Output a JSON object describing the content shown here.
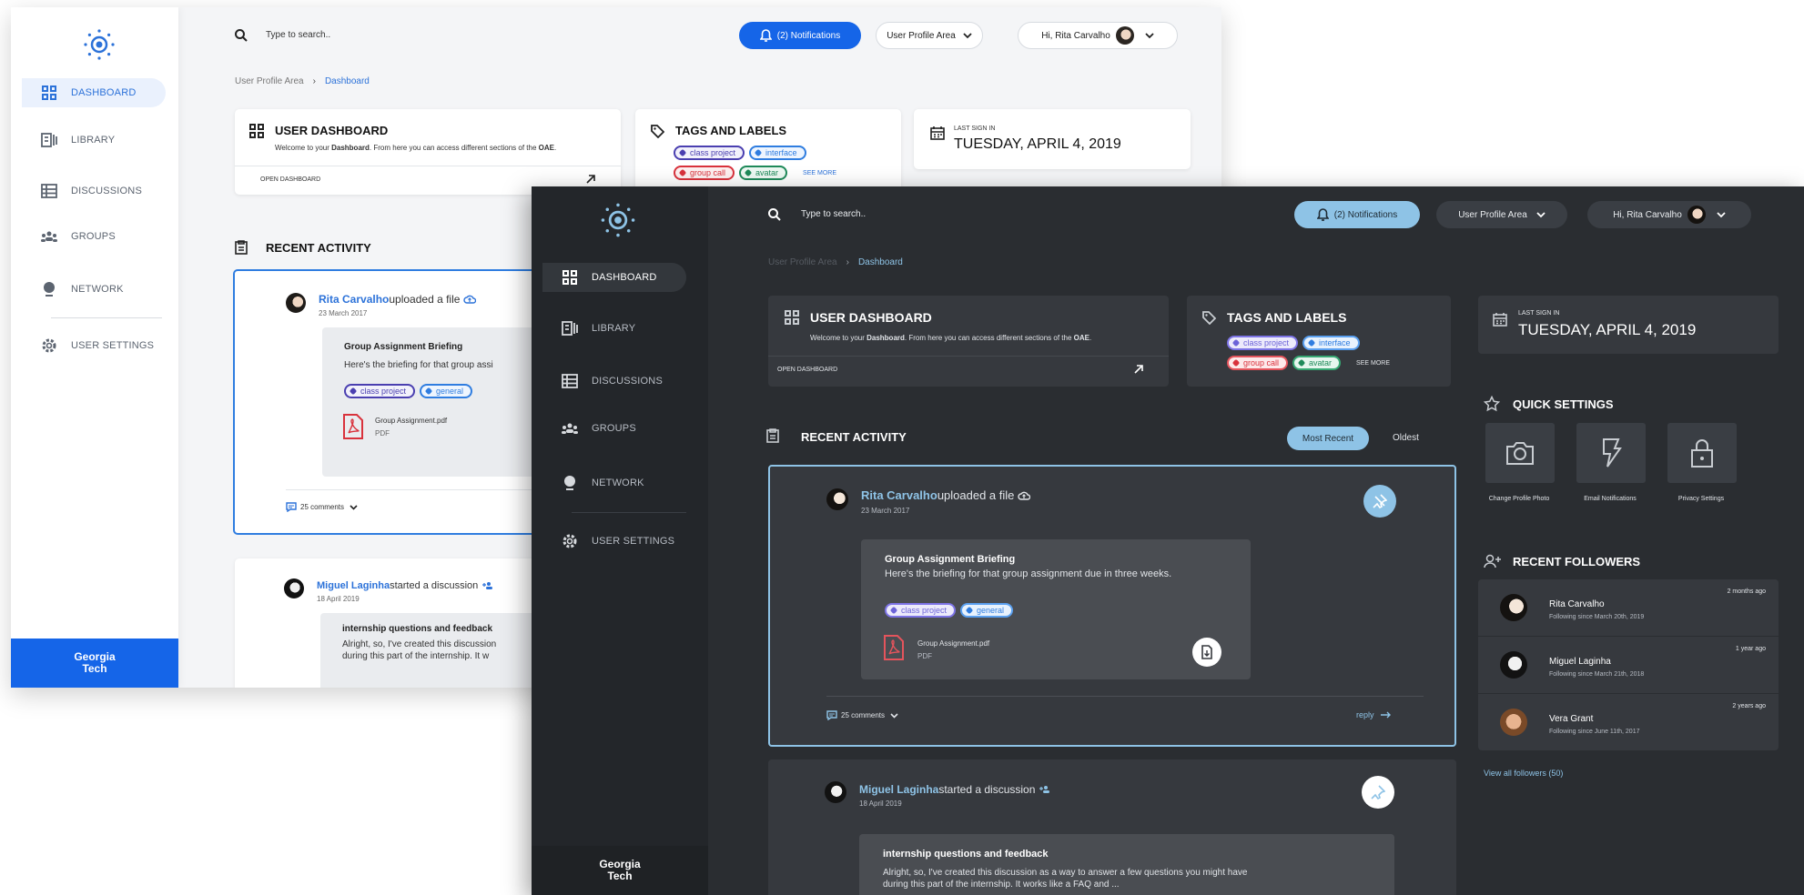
{
  "search": {
    "placeholder": "Type to search.."
  },
  "header": {
    "notifications": "(2) Notifications",
    "profile_area": "User Profile Area",
    "greeting": "Hi, Rita Carvalho"
  },
  "breadcrumb": {
    "parent": "User Profile Area",
    "current": "Dashboard"
  },
  "sidebar": {
    "items": [
      "DASHBOARD",
      "LIBRARY",
      "DISCUSSIONS",
      "GROUPS",
      "NETWORK",
      "USER SETTINGS"
    ],
    "logo_line1": "Georgia",
    "logo_line2": "Tech"
  },
  "dashboard_card": {
    "title": "USER DASHBOARD",
    "desc_pre": "Welcome to your ",
    "desc_bold1": "Dashboard",
    "desc_mid": ". From here you can access different sections of the ",
    "desc_bold2": "OAE",
    "desc_post": ".",
    "link": "OPEN DASHBOARD"
  },
  "tags_card": {
    "title": "TAGS AND LABELS",
    "tags": [
      "class project",
      "interface",
      "group call",
      "avatar"
    ],
    "see_more": "SEE MORE"
  },
  "last_sign_in": {
    "label": "LAST SIGN IN",
    "date": "TUESDAY, APRIL 4, 2019"
  },
  "recent_activity": {
    "title": "RECENT ACTIVITY",
    "sort_recent": "Most Recent",
    "sort_oldest": "Oldest"
  },
  "activity1": {
    "user": "Rita Carvalho",
    "action": " uploaded a file ",
    "date": "23 March 2017",
    "title": "Group Assignment Briefing",
    "body": "Here's the briefing for that group assignment due in three weeks.",
    "body_short": "Here's the briefing for that group assi",
    "tags": [
      "class project",
      "general"
    ],
    "file_name": "Group Assignment.pdf",
    "file_type": "PDF",
    "comments": "25 comments",
    "reply": "reply"
  },
  "activity2": {
    "user": "Miguel Laginha",
    "action": " started a discussion ",
    "date": "18 April 2019",
    "title": "internship questions and feedback",
    "body1": "Alright, so, I've created this discussion as a way to answer a few questions you might have",
    "body2": "during this part of the internship. It works like a FAQ and ...",
    "body1_short": "Alright, so, I've created this discussion",
    "body2_short": "during this part of the internship. It w"
  },
  "quick_settings": {
    "title": "QUICK SETTINGS",
    "items": [
      "Change Profile Photo",
      "Email Notifications",
      "Privacy Settings"
    ]
  },
  "followers": {
    "title": "RECENT FOLLOWERS",
    "items": [
      {
        "name": "Rita Carvalho",
        "since": "Following since March 20th, 2019",
        "ago": "2 months ago"
      },
      {
        "name": "Miguel Laginha",
        "since": "Following since March 21th, 2018",
        "ago": "1 year ago"
      },
      {
        "name": "Vera Grant",
        "since": "Following since June 11th, 2017",
        "ago": "2 years ago"
      }
    ],
    "view_all": "View all followers (50)"
  },
  "colors": {
    "accent": "#2c72d9",
    "gt_blue": "#2c72d9",
    "dark_bg": "#2a2d31",
    "dark_accent": "#8ec3e6"
  }
}
